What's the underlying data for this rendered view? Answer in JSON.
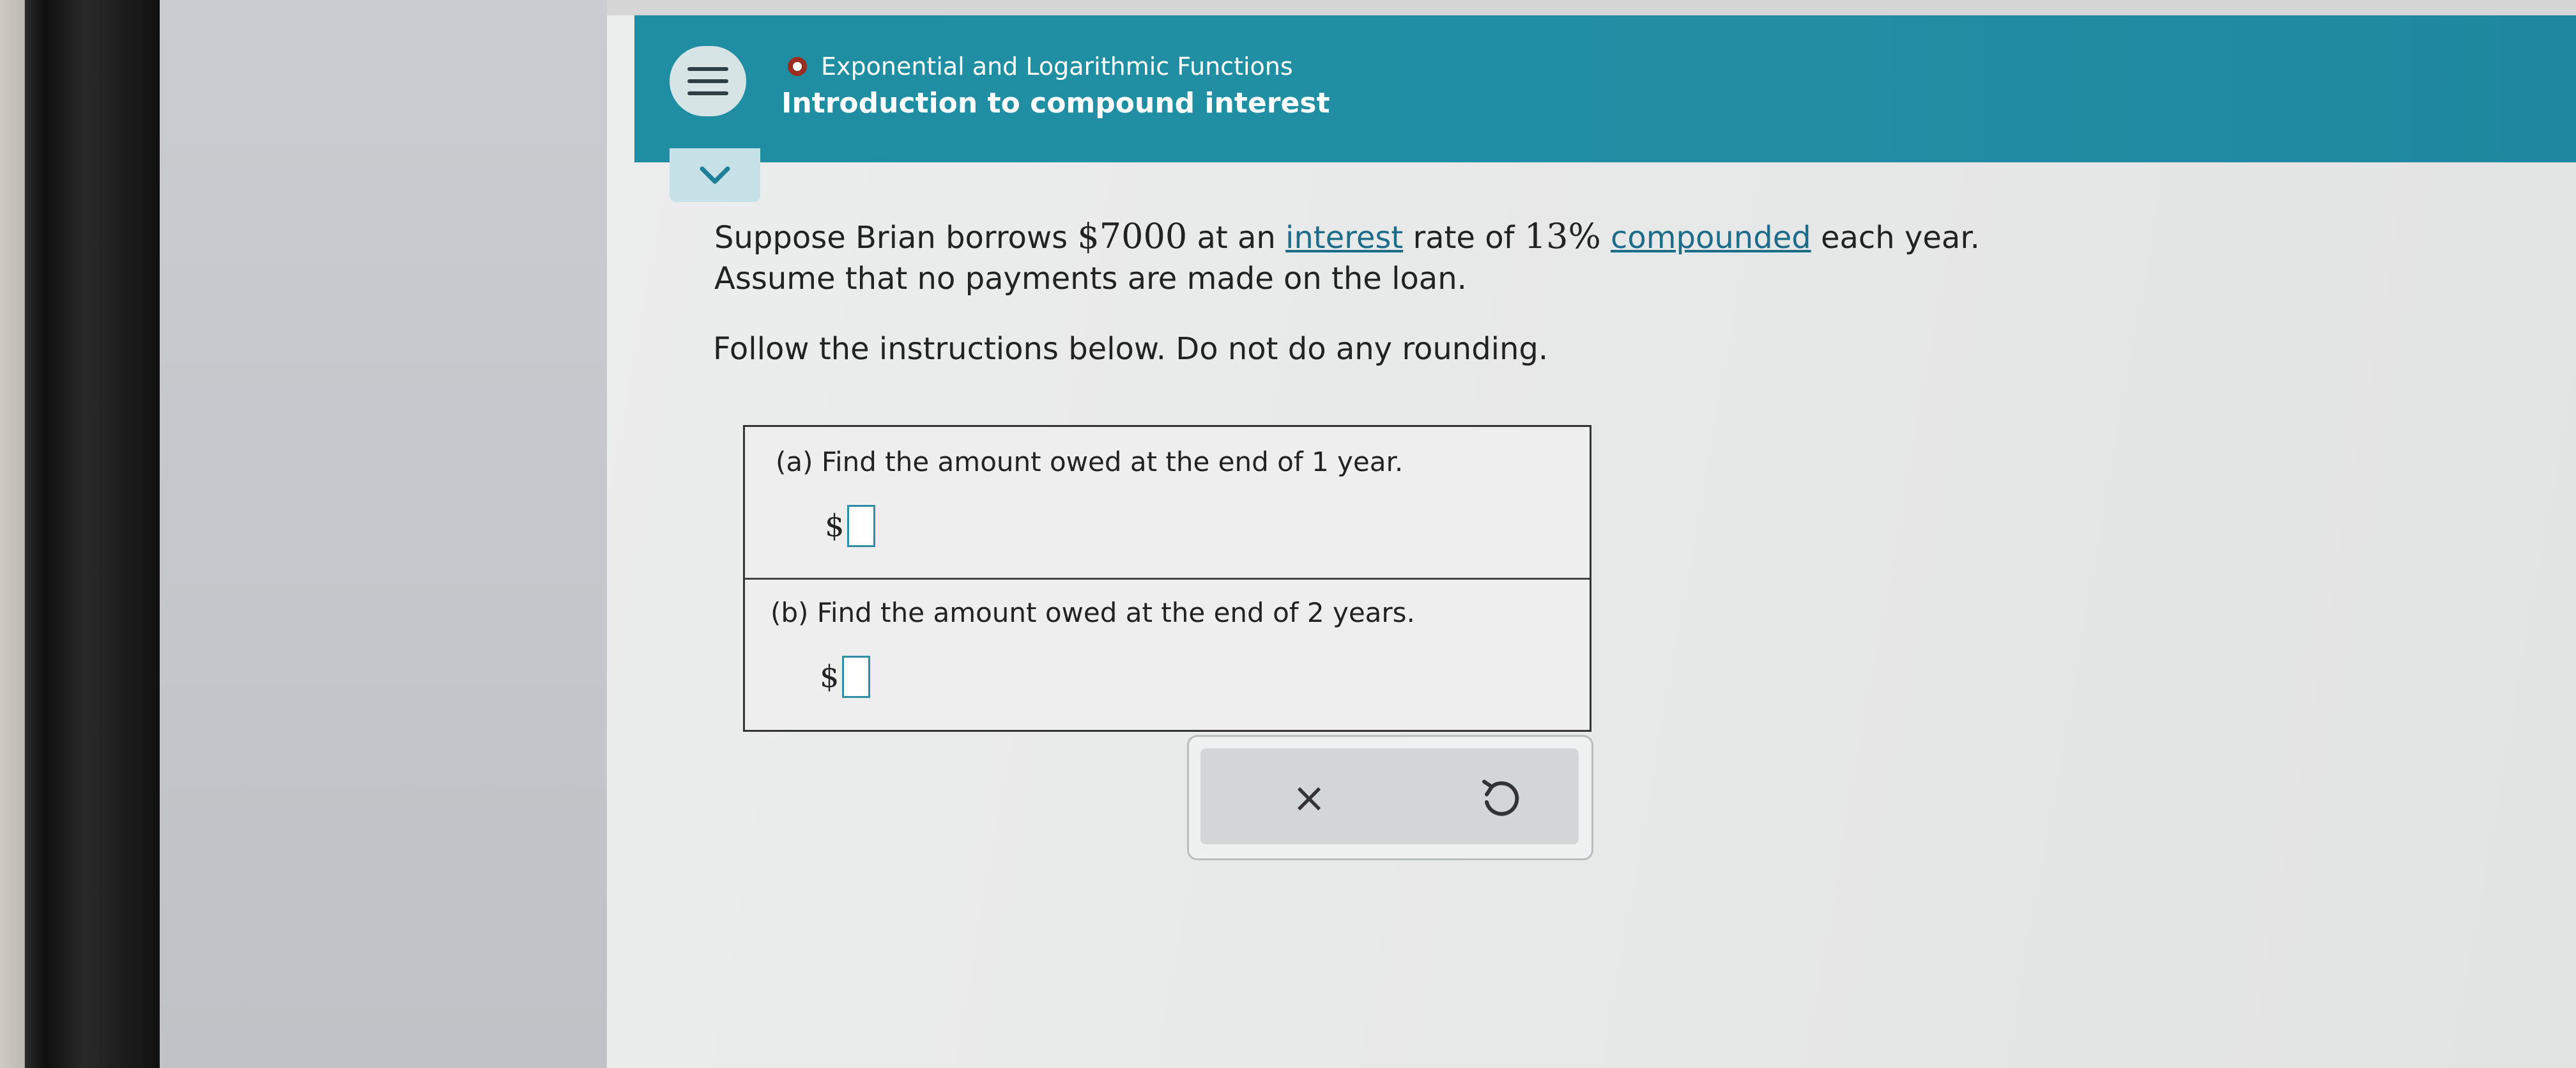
{
  "header": {
    "topic": "Exponential and Logarithmic Functions",
    "title": "Introduction to compound interest"
  },
  "problem": {
    "line1": {
      "a": "Suppose Brian borrows ",
      "amount": "$7000",
      "b": " at an ",
      "term1": "interest",
      "c": " rate of ",
      "rate": "13%",
      "d": " ",
      "term2": "compounded",
      "e": " each year."
    },
    "line2": "Assume that no payments are made on the loan.",
    "instructions": "Follow the instructions below. Do not do any rounding."
  },
  "questions": [
    {
      "prompt": "(a) Find the amount owed at the end of 1 year.",
      "currency": "$",
      "value": ""
    },
    {
      "prompt": "(b) Find the amount owed at the end of 2 years.",
      "currency": "$",
      "value": ""
    }
  ],
  "actions": {
    "clear_symbol": "×"
  },
  "colors": {
    "header": "#218ea4",
    "link": "#1d6d8a",
    "status_ring": "#9a2e23"
  },
  "icons": [
    "menu-icon",
    "chevron-down-icon",
    "close-icon",
    "undo-icon"
  ]
}
